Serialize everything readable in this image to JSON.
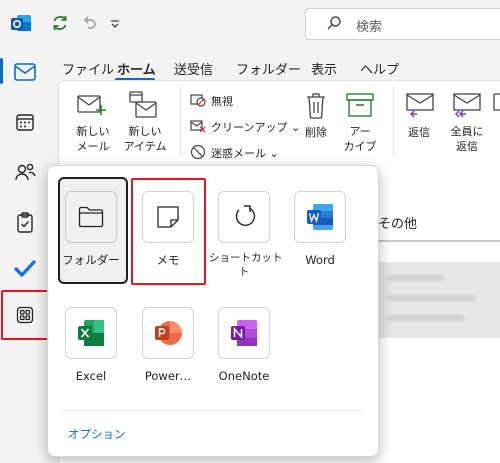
{
  "titlebar": {
    "search_placeholder": "検索"
  },
  "menubar": {
    "tabs": [
      "ファイル",
      "ホーム",
      "送受信",
      "フォルダー",
      "表示",
      "ヘルプ"
    ],
    "active_tab": "ホーム"
  },
  "ribbon": {
    "new_mail": "新しい\nメール",
    "new_items": "新しい\nアイテム",
    "ignore": "無視",
    "cleanup": "クリーンアップ",
    "junk": "迷惑メール",
    "delete": "削除",
    "archive": "アー\nカイブ",
    "reply": "返信",
    "reply_all": "全員に\n返信",
    "truncated": "返"
  },
  "background": {
    "other_label": "その他"
  },
  "flyout": {
    "tiles": [
      {
        "label": "フォルダー"
      },
      {
        "label": "メモ"
      },
      {
        "label": "ショートカット\nト"
      },
      {
        "label": "Word"
      },
      {
        "label": "Excel"
      },
      {
        "label": "Power…"
      },
      {
        "label": "OneNote"
      }
    ],
    "options_link": "オプション"
  },
  "colors": {
    "accent": "#0f6cbd",
    "highlight_red": "#e3171d"
  }
}
